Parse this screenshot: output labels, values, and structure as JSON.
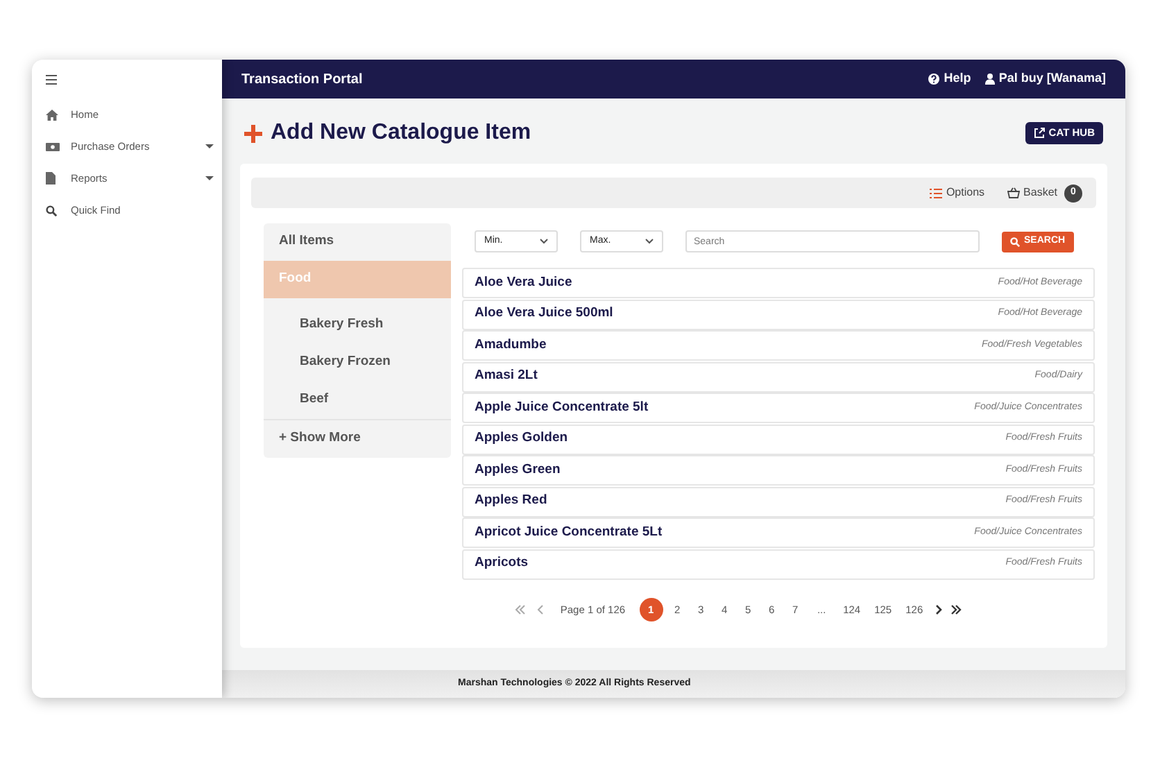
{
  "sidebar": {
    "items": [
      {
        "label": "Home",
        "kind": "link"
      },
      {
        "label": "Purchase Orders",
        "kind": "submenu"
      },
      {
        "label": "Reports",
        "kind": "submenu"
      },
      {
        "label": "Quick Find",
        "kind": "link"
      }
    ]
  },
  "header": {
    "title": "Transaction Portal",
    "help": "Help",
    "user": "Pal buy [Wanama]"
  },
  "page": {
    "title": "Add New Catalogue Item",
    "cat_hub_button": "CAT HUB"
  },
  "toolbar": {
    "options": "Options",
    "basket": "Basket",
    "basket_count": "0"
  },
  "categories": {
    "items": [
      {
        "label": "All Items",
        "selected": false,
        "kind": "top"
      },
      {
        "label": "Food",
        "selected": true,
        "kind": "top"
      },
      {
        "label": "Bakery Fresh",
        "selected": false,
        "kind": "sub"
      },
      {
        "label": "Bakery Frozen",
        "selected": false,
        "kind": "sub"
      },
      {
        "label": "Beef",
        "selected": false,
        "kind": "sub"
      },
      {
        "label": "+ Show More",
        "selected": false,
        "kind": "more"
      }
    ]
  },
  "filters": {
    "min": "Min.",
    "max": "Max.",
    "search_placeholder": "Search",
    "search_button": "SEARCH"
  },
  "products": [
    {
      "name": "Aloe Vera Juice",
      "category": "Food/Hot Beverage"
    },
    {
      "name": "Aloe Vera Juice 500ml",
      "category": "Food/Hot Beverage"
    },
    {
      "name": "Amadumbe",
      "category": "Food/Fresh Vegetables"
    },
    {
      "name": "Amasi 2Lt",
      "category": "Food/Dairy"
    },
    {
      "name": "Apple Juice Concentrate 5lt",
      "category": "Food/Juice Concentrates"
    },
    {
      "name": "Apples Golden",
      "category": "Food/Fresh Fruits"
    },
    {
      "name": "Apples Green",
      "category": "Food/Fresh Fruits"
    },
    {
      "name": "Apples Red",
      "category": "Food/Fresh Fruits"
    },
    {
      "name": "Apricot Juice Concentrate 5Lt",
      "category": "Food/Juice Concentrates"
    },
    {
      "name": "Apricots",
      "category": "Food/Fresh Fruits"
    }
  ],
  "pagination": {
    "page_info": "Page 1 of 126",
    "pages": [
      {
        "label": "1",
        "selected": true
      },
      {
        "label": "2",
        "selected": false
      },
      {
        "label": "3",
        "selected": false
      },
      {
        "label": "4",
        "selected": false
      },
      {
        "label": "5",
        "selected": false
      },
      {
        "label": "6",
        "selected": false
      },
      {
        "label": "7",
        "selected": false
      },
      {
        "label": "...",
        "selected": false
      },
      {
        "label": "124",
        "selected": false
      },
      {
        "label": "125",
        "selected": false
      },
      {
        "label": "126",
        "selected": false
      }
    ]
  },
  "footer": "Marshan Technologies © 2022 All Rights Reserved"
}
